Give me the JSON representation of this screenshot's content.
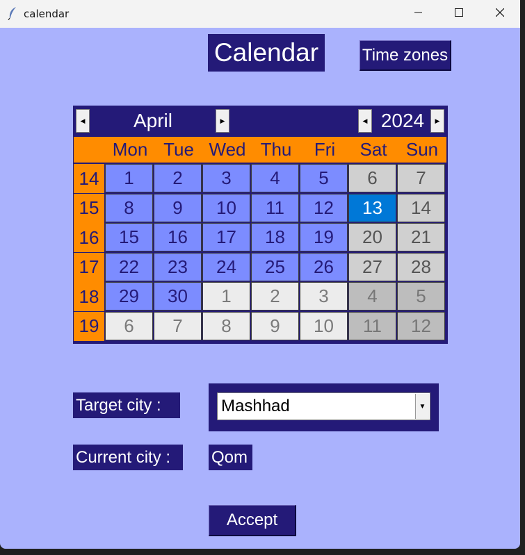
{
  "window": {
    "title": "calendar"
  },
  "header": {
    "title": "Calendar",
    "time_zones_label": "Time zones"
  },
  "calendar": {
    "month": "April",
    "year": "2024",
    "day_names": [
      "Mon",
      "Tue",
      "Wed",
      "Thu",
      "Fri",
      "Sat",
      "Sun"
    ],
    "weeks": [
      {
        "num": "14",
        "days": [
          "1",
          "2",
          "3",
          "4",
          "5",
          "6",
          "7"
        ],
        "kinds": [
          "cur",
          "cur",
          "cur",
          "cur",
          "cur",
          "we",
          "we"
        ]
      },
      {
        "num": "15",
        "days": [
          "8",
          "9",
          "10",
          "11",
          "12",
          "13",
          "14"
        ],
        "kinds": [
          "cur",
          "cur",
          "cur",
          "cur",
          "cur",
          "sel",
          "we"
        ]
      },
      {
        "num": "16",
        "days": [
          "15",
          "16",
          "17",
          "18",
          "19",
          "20",
          "21"
        ],
        "kinds": [
          "cur",
          "cur",
          "cur",
          "cur",
          "cur",
          "we",
          "we"
        ]
      },
      {
        "num": "17",
        "days": [
          "22",
          "23",
          "24",
          "25",
          "26",
          "27",
          "28"
        ],
        "kinds": [
          "cur",
          "cur",
          "cur",
          "cur",
          "cur",
          "we",
          "we"
        ]
      },
      {
        "num": "18",
        "days": [
          "29",
          "30",
          "1",
          "2",
          "3",
          "4",
          "5"
        ],
        "kinds": [
          "cur",
          "cur",
          "oth",
          "oth",
          "oth",
          "othwe",
          "othwe"
        ]
      },
      {
        "num": "19",
        "days": [
          "6",
          "7",
          "8",
          "9",
          "10",
          "11",
          "12"
        ],
        "kinds": [
          "oth",
          "oth",
          "oth",
          "oth",
          "oth",
          "othwe",
          "othwe"
        ]
      }
    ],
    "selected_day": "13"
  },
  "form": {
    "target_city_label": "Target city :",
    "target_city_value": "Mashhad",
    "current_city_label": "Current city :",
    "current_city_value": "Qom",
    "accept_label": "Accept"
  },
  "colors": {
    "background": "#aab2fd",
    "dark": "#241a78",
    "orange": "#ff8c00",
    "current_month": "#7c8cff",
    "weekend": "#d0d0d0",
    "selected": "#0078d7"
  },
  "icons": [
    "feather-icon",
    "minimize-icon",
    "maximize-icon",
    "close-icon",
    "arrow-left-icon",
    "arrow-right-icon",
    "dropdown-arrow-icon"
  ]
}
